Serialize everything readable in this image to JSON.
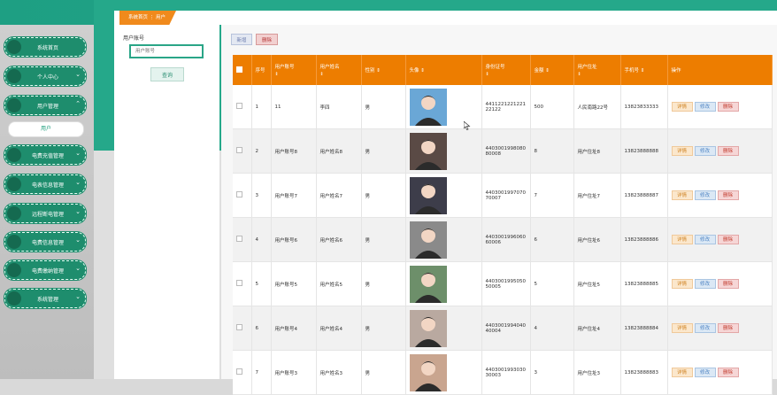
{
  "sidebar": {
    "menu": [
      {
        "label": "系统首页",
        "chevron": false
      },
      {
        "label": "个人中心",
        "chevron": true
      },
      {
        "label": "用户管理",
        "chevron": true,
        "expanded": true
      },
      {
        "label": "电费充值管理",
        "chevron": true
      },
      {
        "label": "电表信息管理",
        "chevron": true
      },
      {
        "label": "远程断电管理",
        "chevron": true
      },
      {
        "label": "电费信息管理",
        "chevron": true
      },
      {
        "label": "电费缴纳管理",
        "chevron": true
      },
      {
        "label": "系统管理",
        "chevron": true
      }
    ],
    "submenu_item": "用户"
  },
  "breadcrumb": "系统首页 ⋮ 用户",
  "search": {
    "label": "用户账号",
    "placeholder": "用户账号",
    "button": "查询"
  },
  "toolbar": {
    "add_label": "新增",
    "delete_label": "删除"
  },
  "table": {
    "headers": [
      "序号",
      "用户账号",
      "用户姓名",
      "性别",
      "头像",
      "身份证号",
      "金额",
      "用户住址",
      "手机号",
      "操作"
    ],
    "actions": {
      "detail": "详情",
      "edit": "修改",
      "delete": "删除"
    },
    "rows": [
      {
        "no": "1",
        "account": "11",
        "name": "李四",
        "gender": "男",
        "id_card": "441122122122122122",
        "amount": "500",
        "address": "人民南路22号",
        "phone": "13823833333",
        "avatar_color": "#6aa7d6"
      },
      {
        "no": "2",
        "account": "用户账号8",
        "name": "用户姓名8",
        "gender": "男",
        "id_card": "440300199808080008",
        "amount": "8",
        "address": "用户住址8",
        "phone": "13823888888",
        "avatar_color": "#5a4a45"
      },
      {
        "no": "3",
        "account": "用户账号7",
        "name": "用户姓名7",
        "gender": "男",
        "id_card": "440300199707070007",
        "amount": "7",
        "address": "用户住址7",
        "phone": "13823888887",
        "avatar_color": "#3d3d4a"
      },
      {
        "no": "4",
        "account": "用户账号6",
        "name": "用户姓名6",
        "gender": "男",
        "id_card": "440300199606060006",
        "amount": "6",
        "address": "用户住址6",
        "phone": "13823888886",
        "avatar_color": "#8a8a8a"
      },
      {
        "no": "5",
        "account": "用户账号5",
        "name": "用户姓名5",
        "gender": "男",
        "id_card": "440300199505050005",
        "amount": "5",
        "address": "用户住址5",
        "phone": "13823888885",
        "avatar_color": "#6d8f6a"
      },
      {
        "no": "6",
        "account": "用户账号4",
        "name": "用户姓名4",
        "gender": "男",
        "id_card": "440300199404040004",
        "amount": "4",
        "address": "用户住址4",
        "phone": "13823888884",
        "avatar_color": "#b9a9a0"
      },
      {
        "no": "7",
        "account": "用户账号3",
        "name": "用户姓名3",
        "gender": "男",
        "id_card": "440300199303030003",
        "amount": "3",
        "address": "用户住址3",
        "phone": "13823888883",
        "avatar_color": "#c9a58f"
      }
    ]
  },
  "colors": {
    "brand_green": "#25a88a",
    "header_orange": "#ed7d00"
  }
}
